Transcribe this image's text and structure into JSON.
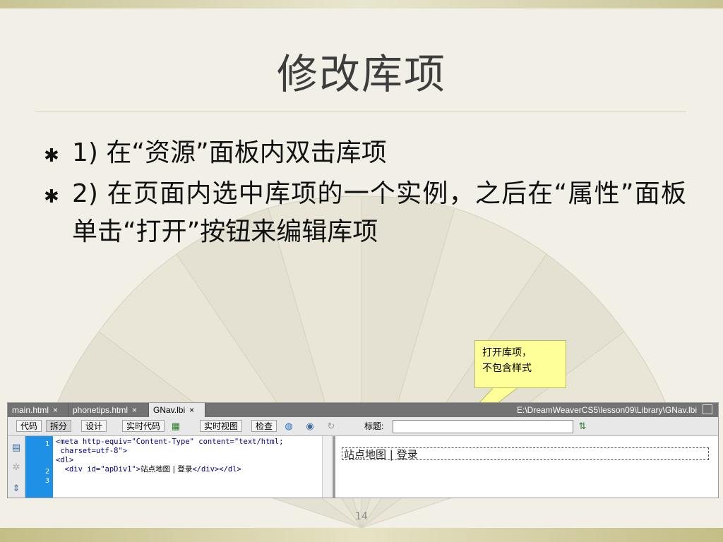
{
  "slide": {
    "title": "修改库项",
    "bullets": [
      {
        "mark": "✱",
        "text": "1) 在“资源”面板内双击库项"
      },
      {
        "mark": "✱",
        "text": "2)  在页面内选中库项的一个实例，之后在“属性”面板单击“打开”按钮来编辑库项"
      }
    ],
    "callout": [
      "打开库项，",
      "不包含样式"
    ],
    "page_number": "14"
  },
  "dw": {
    "tabs": [
      {
        "label": "main.html",
        "close": "×"
      },
      {
        "label": "phonetips.html",
        "close": "×"
      },
      {
        "label": "GNav.lbi",
        "close": "×"
      }
    ],
    "path": "E:\\DreamWeaverCS5\\lesson09\\Library\\GNav.lbi",
    "toolbar": {
      "code": "代码",
      "split": "拆分",
      "design": "设计",
      "live_code": "实时代码",
      "live_view": "实时视图",
      "inspect": "检查",
      "title_label": "标题:"
    },
    "lines": [
      {
        "num": "1",
        "text": "<meta http-equiv=\"Content-Type\" content=\"text/html;"
      },
      {
        "num": "",
        "text": " charset=utf-8\">"
      },
      {
        "num": "2",
        "text": "<dl>"
      },
      {
        "num": "3",
        "pre": "  <div id=\"apDiv1\">",
        "plain": "站点地图 | 登录",
        "post": "</div></dl>"
      }
    ],
    "design_text": "站点地图 | 登录"
  }
}
